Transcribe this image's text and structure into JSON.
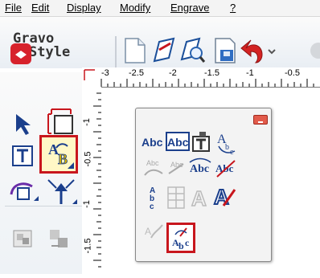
{
  "menu": {
    "file": "File",
    "edit": "Edit",
    "display": "Display",
    "modify": "Modify",
    "engrave": "Engrave",
    "help": "?"
  },
  "logo": {
    "line1": "Gravo",
    "line2": "Style"
  },
  "ruler": {
    "top_labels": [
      "-3",
      "-2.5",
      "-2",
      "-1.5",
      "-1",
      "-0.5"
    ],
    "left_labels": [
      "-1",
      "-0.5",
      "-1",
      "-1.5"
    ]
  },
  "text_tools_popup": {
    "row1": [
      "Abc",
      "Abc"
    ],
    "highlighted_tool": "vertical-text-on-path"
  },
  "colors": {
    "highlight": "#c8161d",
    "accent_blue": "#1b5fb8",
    "logo_red": "#d7222c"
  }
}
